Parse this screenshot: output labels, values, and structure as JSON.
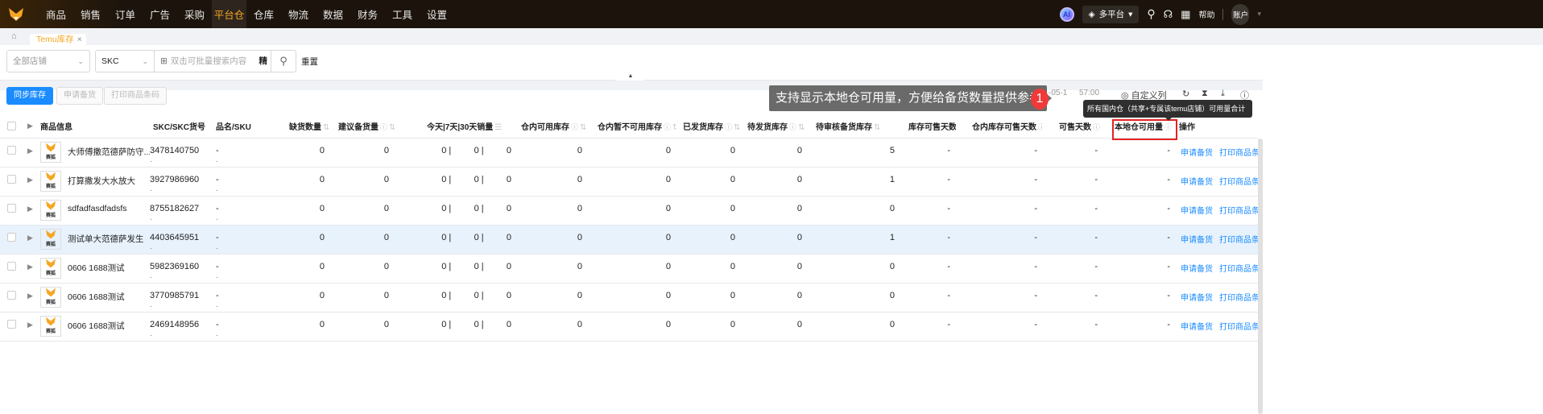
{
  "nav": {
    "items": [
      "商品",
      "销售",
      "订单",
      "广告",
      "采购",
      "平台仓",
      "仓库",
      "物流",
      "数据",
      "财务",
      "工具",
      "设置"
    ],
    "active": "平台仓",
    "ai": "AI",
    "platform": "多平台",
    "help": "帮助",
    "account": "账户"
  },
  "tabs": [
    {
      "label": "Temu库存",
      "close": "×"
    }
  ],
  "filters": {
    "store": "全部店铺",
    "search_type": "SKC",
    "search_placeholder": "双击可批量搜索内容",
    "exact": "精",
    "reset": "重置"
  },
  "toolbar": {
    "sync": "同步库存",
    "apply": "申请备货",
    "print": "打印商品条码",
    "time_a": "-05-1",
    "time_b": "57:00",
    "custom_columns": "自定义列"
  },
  "callout": {
    "number": "1",
    "text": "支持显示本地仓可用量，方便给备货数量提供参考"
  },
  "tooltip": "所有国内仓（共享+专属该temu店铺）可用量合计",
  "columns": [
    "商品信息",
    "SKC/SKC货号",
    "品名/SKU",
    "缺货数量",
    "建议备货量",
    "今天|7天|30天销量",
    "仓内可用库存",
    "仓内暂不可用库存",
    "已发货库存",
    "待发货库存",
    "待审核备货库存",
    "库存可售天数",
    "仓内库存可售天数",
    "可售天数",
    "本地仓可用量",
    "操作"
  ],
  "thumb_label": "赛狐",
  "row_actions": [
    "申请备货",
    "打印商品条码"
  ],
  "rows": [
    {
      "name": "大师傅撒范德萨防守...",
      "skc": "3478140750",
      "skc_no": "-",
      "sku": "-",
      "sku2": "-",
      "short": "0",
      "suggest": "0",
      "sales": [
        "0",
        "0",
        "0"
      ],
      "avail": "0",
      "unavail": "0",
      "shipped": "0",
      "pending": "0",
      "review": "5",
      "days": "-",
      "wh_days": "-",
      "sell_days": "-",
      "local": "-"
    },
    {
      "name": "打算撒发大水放大",
      "skc": "3927986960",
      "skc_no": "-",
      "sku": "-",
      "sku2": "-",
      "short": "0",
      "suggest": "0",
      "sales": [
        "0",
        "0",
        "0"
      ],
      "avail": "0",
      "unavail": "0",
      "shipped": "0",
      "pending": "0",
      "review": "1",
      "days": "-",
      "wh_days": "-",
      "sell_days": "-",
      "local": "-"
    },
    {
      "name": "sdfadfasdfadsfs",
      "skc": "8755182627",
      "skc_no": "-",
      "sku": "-",
      "sku2": "-",
      "short": "0",
      "suggest": "0",
      "sales": [
        "0",
        "0",
        "0"
      ],
      "avail": "0",
      "unavail": "0",
      "shipped": "0",
      "pending": "0",
      "review": "0",
      "days": "-",
      "wh_days": "-",
      "sell_days": "-",
      "local": "-"
    },
    {
      "name": "测试单大范德萨发生",
      "skc": "4403645951",
      "skc_no": "-",
      "sku": "-",
      "sku2": "-",
      "short": "0",
      "suggest": "0",
      "sales": [
        "0",
        "0",
        "0"
      ],
      "avail": "0",
      "unavail": "0",
      "shipped": "0",
      "pending": "0",
      "review": "1",
      "days": "-",
      "wh_days": "-",
      "sell_days": "-",
      "local": "-"
    },
    {
      "name": "0606 1688测试",
      "skc": "5982369160",
      "skc_no": "-",
      "sku": "-",
      "sku2": "-",
      "short": "0",
      "suggest": "0",
      "sales": [
        "0",
        "0",
        "0"
      ],
      "avail": "0",
      "unavail": "0",
      "shipped": "0",
      "pending": "0",
      "review": "0",
      "days": "-",
      "wh_days": "-",
      "sell_days": "-",
      "local": "-"
    },
    {
      "name": "0606 1688测试",
      "skc": "3770985791",
      "skc_no": "-",
      "sku": "-",
      "sku2": "-",
      "short": "0",
      "suggest": "0",
      "sales": [
        "0",
        "0",
        "0"
      ],
      "avail": "0",
      "unavail": "0",
      "shipped": "0",
      "pending": "0",
      "review": "0",
      "days": "-",
      "wh_days": "-",
      "sell_days": "-",
      "local": "-"
    },
    {
      "name": "0606 1688测试",
      "skc": "2469148956",
      "skc_no": "-",
      "sku": "-",
      "sku2": "-",
      "short": "0",
      "suggest": "0",
      "sales": [
        "0",
        "0",
        "0"
      ],
      "avail": "0",
      "unavail": "0",
      "shipped": "0",
      "pending": "0",
      "review": "0",
      "days": "-",
      "wh_days": "-",
      "sell_days": "-",
      "local": "-"
    }
  ],
  "highlight_row": 3,
  "colors": {
    "accent": "#f5a623",
    "primary": "#1a8cff",
    "highlight": "#e8f2fc",
    "callout_red": "#f03a3a"
  }
}
